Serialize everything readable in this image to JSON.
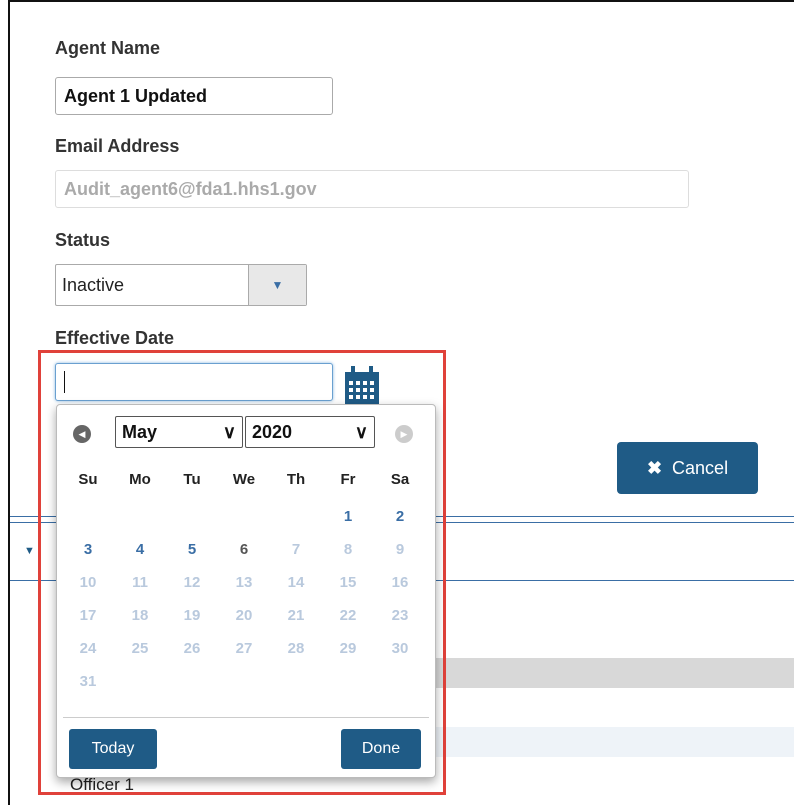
{
  "form": {
    "agent_name_label": "Agent Name",
    "agent_name_value": "Agent 1 Updated",
    "email_label": "Email Address",
    "email_value": "Audit_agent6@fda1.hhs1.gov",
    "status_label": "Status",
    "status_value": "Inactive",
    "effective_date_label": "Effective Date",
    "effective_date_value": ""
  },
  "cancel_button": {
    "label": "Cancel",
    "icon": "x-icon"
  },
  "background": {
    "row_text": "Officer 1"
  },
  "datepicker": {
    "month": "May",
    "year": "2020",
    "weekdays": [
      "Su",
      "Mo",
      "Tu",
      "We",
      "Th",
      "Fr",
      "Sa"
    ],
    "weeks": [
      [
        "",
        "",
        "",
        "",
        "",
        "1",
        "2"
      ],
      [
        "3",
        "4",
        "5",
        "6",
        "7",
        "8",
        "9"
      ],
      [
        "10",
        "11",
        "12",
        "13",
        "14",
        "15",
        "16"
      ],
      [
        "17",
        "18",
        "19",
        "20",
        "21",
        "22",
        "23"
      ],
      [
        "24",
        "25",
        "26",
        "27",
        "28",
        "29",
        "30"
      ],
      [
        "31",
        "",
        "",
        "",
        "",
        "",
        ""
      ]
    ],
    "selectable_days": [
      "1",
      "2",
      "3",
      "4",
      "5",
      "6"
    ],
    "today": "6",
    "today_button": "Today",
    "done_button": "Done"
  },
  "colors": {
    "primary_button": "#1f5b86",
    "highlight_border": "#e0413a",
    "active_day": "#3a6ea5",
    "inactive_day": "#b9c9dd"
  }
}
